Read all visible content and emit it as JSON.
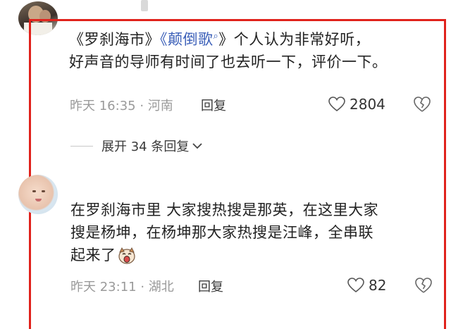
{
  "comments": [
    {
      "text_line1_prefix": "《罗刹海市》",
      "text_line1_link": "《颠倒歌",
      "text_line1_link_icon": "search-icon",
      "text_line1_suffix": "》个人认为非常好听，",
      "text_line2": "好声音的导师有时间了也去听一下，评价一下。",
      "meta": "昨天 16:35 · 河南",
      "reply_label": "回复",
      "like_count": "2804",
      "expand_label": "展开 34 条回复"
    },
    {
      "text_line1": "在罗刹海市里 大家搜热搜是那英，在这里大家",
      "text_line2": "搜是杨坤，在杨坤那大家热搜是汪峰，全串联",
      "text_line3": "起来了",
      "emoji": "laughing-dog-emoji",
      "meta": "昨天 23:11 · 湖北",
      "reply_label": "回复",
      "like_count": "82"
    }
  ],
  "colors": {
    "highlight_frame": "#e0221c",
    "link": "#3b5fb8",
    "meta_text": "#9a9a9a"
  }
}
